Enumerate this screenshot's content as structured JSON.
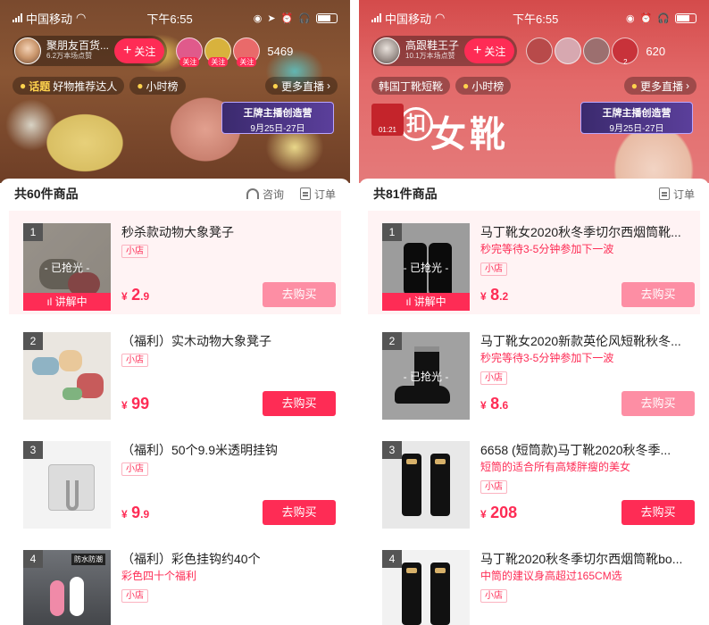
{
  "left": {
    "status": {
      "carrier": "中国移动",
      "time": "下午6:55"
    },
    "host": {
      "name": "聚朋友百货...",
      "sub": "6.2万本场点赞",
      "follow": "关注"
    },
    "viewer_tags": [
      "关注",
      "关注",
      "关注"
    ],
    "viewer_colors": [
      "#e05a8b",
      "#d8b23d",
      "#e96a6a"
    ],
    "viewer_count": "5469",
    "topics": {
      "topic_label": "话题",
      "topic_text": "好物推荐达人",
      "hourly": "小时榜",
      "more": "更多直播"
    },
    "banner": {
      "title": "王牌主播创造营",
      "date": "9月25日-27日"
    },
    "sheet": {
      "title": "共60件商品",
      "service": "咨询",
      "orders": "订单"
    },
    "items": [
      {
        "rank": "1",
        "title": "秒杀款动物大象凳子",
        "subtitle": "",
        "shop": "小店",
        "cur": "¥",
        "int": "2",
        "dec": ".9",
        "buy": "去购买",
        "soldout": "- 已抢光 -",
        "explain": "讲解中"
      },
      {
        "rank": "2",
        "title": "（福利）实木动物大象凳子",
        "subtitle": "",
        "shop": "小店",
        "cur": "¥",
        "int": "99",
        "dec": "",
        "buy": "去购买"
      },
      {
        "rank": "3",
        "title": "（福利）50个9.9米透明挂钩",
        "subtitle": "",
        "shop": "小店",
        "cur": "¥",
        "int": "9",
        "dec": ".9",
        "buy": "去购买"
      },
      {
        "rank": "4",
        "title": "（福利）彩色挂钩约40个",
        "subtitle": "彩色四十个福利",
        "shop": "小店",
        "label": "防水防潮"
      }
    ]
  },
  "right": {
    "status": {
      "carrier": "中国移动",
      "time": "下午6:55"
    },
    "host": {
      "name": "高跟鞋王子",
      "sub": "10.1万本场点赞",
      "follow": "关注"
    },
    "viewer_tags": [
      "",
      "",
      "",
      "2"
    ],
    "viewer_colors": [
      "#b84a4a",
      "#d7a8b0",
      "#9c6f6f",
      "#c8323a"
    ],
    "viewer_count": "620",
    "topics": {
      "topic_text": "韩国丁靴短靴",
      "hourly": "小时榜",
      "more": "更多直播"
    },
    "mini_live": "01:21",
    "sign": {
      "circle": "扣",
      "text": "女靴"
    },
    "banner": {
      "title": "王牌主播创造营",
      "date": "9月25日-27日"
    },
    "sheet": {
      "title": "共81件商品",
      "orders": "订单"
    },
    "items": [
      {
        "rank": "1",
        "title": "马丁靴女2020秋冬季切尔西烟筒靴...",
        "subtitle": "秒完等待3-5分钟参加下一波",
        "shop": "小店",
        "cur": "¥",
        "int": "8",
        "dec": ".2",
        "buy": "去购买",
        "soldout": "- 已抢光 -",
        "explain": "讲解中"
      },
      {
        "rank": "2",
        "title": "马丁靴女2020新款英伦风短靴秋冬...",
        "subtitle": "秒完等待3-5分钟参加下一波",
        "shop": "小店",
        "cur": "¥",
        "int": "8",
        "dec": ".6",
        "buy": "去购买",
        "soldout": "- 已抢光 -"
      },
      {
        "rank": "3",
        "title": "6658 (短筒款)马丁靴2020秋冬季...",
        "subtitle": "短筒的适合所有高矮胖瘦的美女",
        "shop": "小店",
        "cur": "¥",
        "int": "208",
        "dec": "",
        "buy": "去购买"
      },
      {
        "rank": "4",
        "title": "马丁靴2020秋冬季切尔西烟筒靴bo...",
        "subtitle": "中筒的建议身高超过165CM选",
        "shop": "小店"
      }
    ]
  }
}
